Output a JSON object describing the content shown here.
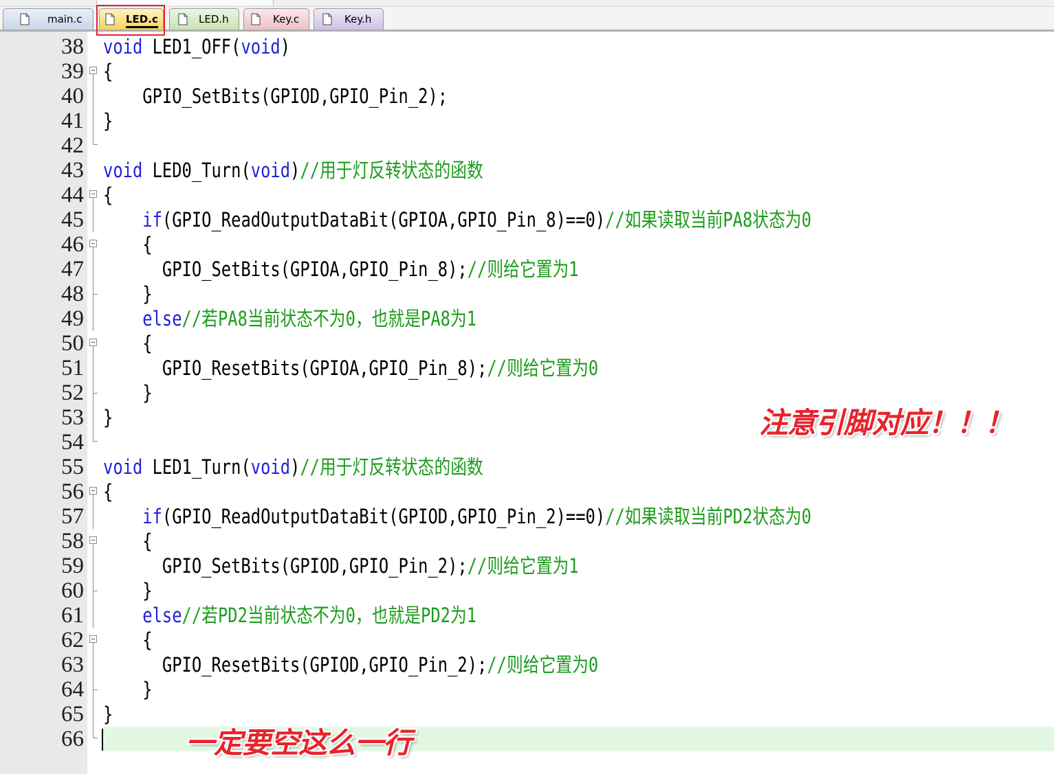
{
  "tabs": [
    {
      "label": "main.c"
    },
    {
      "label": "LED.c",
      "active": true
    },
    {
      "label": "LED.h"
    },
    {
      "label": "Key.c"
    },
    {
      "label": "Key.h"
    }
  ],
  "colors": {
    "keyword": "#1f1fdc",
    "comment": "#1c9c1c",
    "annotation": "#e8232c",
    "current_line": "#e3f8e3",
    "active_tab_outline": "#e8202b"
  },
  "editor": {
    "lines": [
      {
        "num": "38",
        "segs": [
          {
            "t": "void",
            "c": "kw"
          },
          {
            "t": " LED1_OFF("
          },
          {
            "t": "void",
            "c": "kw"
          },
          {
            "t": ")"
          }
        ]
      },
      {
        "num": "39",
        "segs": [
          {
            "t": "{"
          }
        ]
      },
      {
        "num": "40",
        "segs": [
          {
            "t": "    GPIO_SetBits(GPIOD,GPIO_Pin_2);"
          }
        ]
      },
      {
        "num": "41",
        "segs": [
          {
            "t": "}"
          }
        ]
      },
      {
        "num": "42",
        "segs": []
      },
      {
        "num": "43",
        "segs": [
          {
            "t": "void",
            "c": "kw"
          },
          {
            "t": " LED0_Turn("
          },
          {
            "t": "void",
            "c": "kw"
          },
          {
            "t": ")"
          },
          {
            "t": "//用于灯反转状态的函数",
            "c": "cm"
          }
        ]
      },
      {
        "num": "44",
        "segs": [
          {
            "t": "{"
          }
        ]
      },
      {
        "num": "45",
        "segs": [
          {
            "t": "    "
          },
          {
            "t": "if",
            "c": "kw"
          },
          {
            "t": "(GPIO_ReadOutputDataBit(GPIOA,GPIO_Pin_8)==0)"
          },
          {
            "t": "//如果读取当前PA8状态为0",
            "c": "cm"
          }
        ]
      },
      {
        "num": "46",
        "segs": [
          {
            "t": "    {"
          }
        ]
      },
      {
        "num": "47",
        "segs": [
          {
            "t": "      GPIO_SetBits(GPIOA,GPIO_Pin_8);"
          },
          {
            "t": "//则给它置为1",
            "c": "cm"
          }
        ]
      },
      {
        "num": "48",
        "segs": [
          {
            "t": "    }"
          }
        ]
      },
      {
        "num": "49",
        "segs": [
          {
            "t": "    "
          },
          {
            "t": "else",
            "c": "kw"
          },
          {
            "t": "//若PA8当前状态不为0，也就是PA8为1",
            "c": "cm"
          }
        ]
      },
      {
        "num": "50",
        "segs": [
          {
            "t": "    {"
          }
        ]
      },
      {
        "num": "51",
        "segs": [
          {
            "t": "      GPIO_ResetBits(GPIOA,GPIO_Pin_8);"
          },
          {
            "t": "//则给它置为0",
            "c": "cm"
          }
        ]
      },
      {
        "num": "52",
        "segs": [
          {
            "t": "    }"
          }
        ]
      },
      {
        "num": "53",
        "segs": [
          {
            "t": "}"
          }
        ]
      },
      {
        "num": "54",
        "segs": []
      },
      {
        "num": "55",
        "segs": [
          {
            "t": "void",
            "c": "kw"
          },
          {
            "t": " LED1_Turn("
          },
          {
            "t": "void",
            "c": "kw"
          },
          {
            "t": ")"
          },
          {
            "t": "//用于灯反转状态的函数",
            "c": "cm"
          }
        ]
      },
      {
        "num": "56",
        "segs": [
          {
            "t": "{"
          }
        ]
      },
      {
        "num": "57",
        "segs": [
          {
            "t": "    "
          },
          {
            "t": "if",
            "c": "kw"
          },
          {
            "t": "(GPIO_ReadOutputDataBit(GPIOD,GPIO_Pin_2)==0)"
          },
          {
            "t": "//如果读取当前PD2状态为0",
            "c": "cm"
          }
        ]
      },
      {
        "num": "58",
        "segs": [
          {
            "t": "    {"
          }
        ]
      },
      {
        "num": "59",
        "segs": [
          {
            "t": "      GPIO_SetBits(GPIOD,GPIO_Pin_2);"
          },
          {
            "t": "//则给它置为1",
            "c": "cm"
          }
        ]
      },
      {
        "num": "60",
        "segs": [
          {
            "t": "    }"
          }
        ]
      },
      {
        "num": "61",
        "segs": [
          {
            "t": "    "
          },
          {
            "t": "else",
            "c": "kw"
          },
          {
            "t": "//若PD2当前状态不为0，也就是PD2为1",
            "c": "cm"
          }
        ]
      },
      {
        "num": "62",
        "segs": [
          {
            "t": "    {"
          }
        ]
      },
      {
        "num": "63",
        "segs": [
          {
            "t": "      GPIO_ResetBits(GPIOD,GPIO_Pin_2);"
          },
          {
            "t": "//则给它置为0",
            "c": "cm"
          }
        ]
      },
      {
        "num": "64",
        "segs": [
          {
            "t": "    }"
          }
        ]
      },
      {
        "num": "65",
        "segs": [
          {
            "t": "}"
          }
        ]
      },
      {
        "num": "66",
        "segs": [],
        "current": true
      }
    ]
  },
  "annotations": {
    "pins_note": "注意引脚对应！！！",
    "blank_line_note": "一定要空这么一行"
  }
}
